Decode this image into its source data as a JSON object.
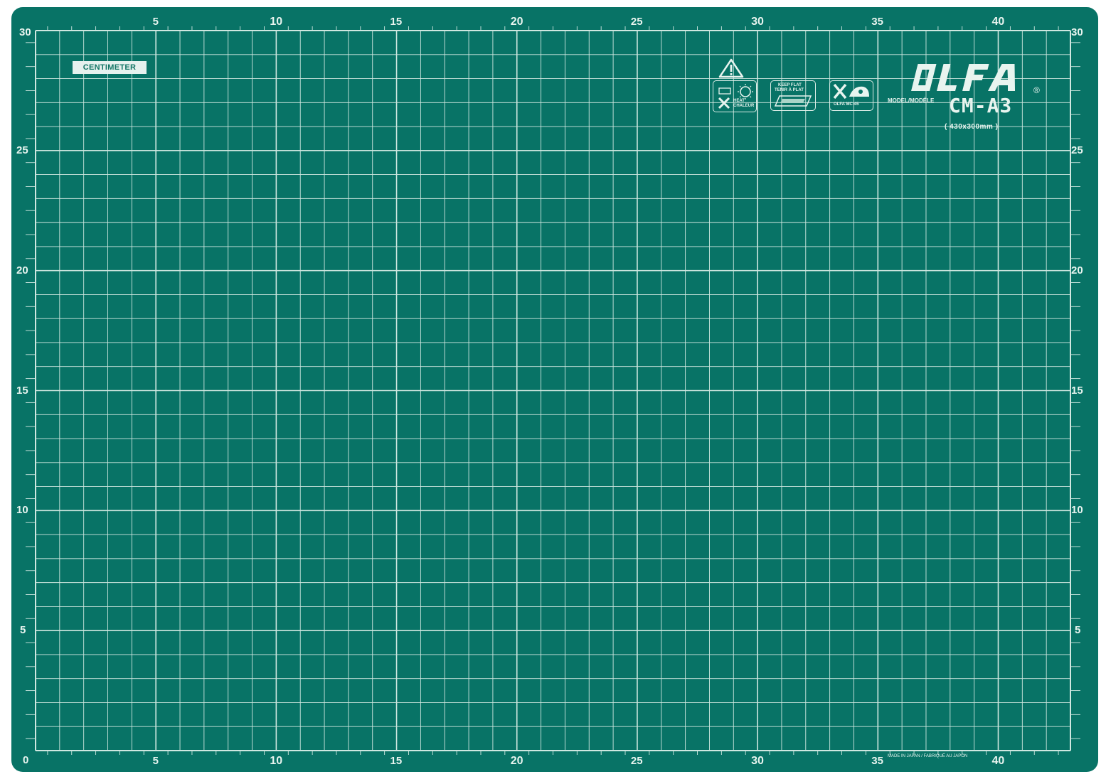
{
  "mat": {
    "width_cm": 43,
    "height_cm": 30,
    "background_color": "#087366",
    "grid_color": "#cfe7e0",
    "x_labels": [
      "5",
      "10",
      "15",
      "20",
      "25",
      "30",
      "35",
      "40"
    ],
    "y_labels": [
      "30",
      "25",
      "20",
      "15",
      "10",
      "5"
    ],
    "origin_label": "0"
  },
  "labels": {
    "centimeter": "CENTIMETER",
    "brand": "OLFA",
    "registered": "®",
    "model_label": "MODEL/MODÈLE",
    "model_name": "CM-A3",
    "model_size": "( 430x300mm )",
    "made_in": "MADE IN JAPAN / FABRIQUÉ AU JAPON"
  },
  "icons": {
    "warning": "warning-triangle-icon",
    "heat_line1": "HEAT",
    "heat_line2": "CHALEUR",
    "keep_flat_line1": "KEEP FLAT",
    "keep_flat_line2": "TENIR À PLAT",
    "olfa_mc45": "OLFA MC-45"
  }
}
